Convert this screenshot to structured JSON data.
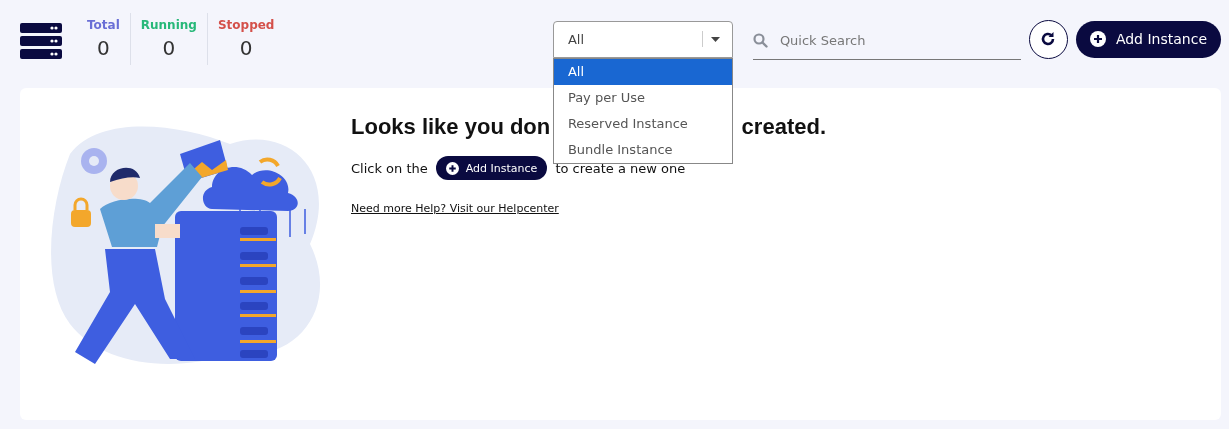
{
  "stats": [
    {
      "label": "Total",
      "value": "0",
      "color": "#6a6fd6"
    },
    {
      "label": "Running",
      "value": "0",
      "color": "#27b879"
    },
    {
      "label": "Stopped",
      "value": "0",
      "color": "#d4504a"
    }
  ],
  "filter": {
    "value": "All",
    "expanded": true,
    "options": [
      {
        "label": "All",
        "selected": true
      },
      {
        "label": "Pay per Use",
        "selected": false
      },
      {
        "label": "Reserved Instance",
        "selected": false
      },
      {
        "label": "Bundle Instance",
        "selected": false
      }
    ]
  },
  "search": {
    "placeholder": "Quick Search"
  },
  "add_button": {
    "label": "Add Instance"
  },
  "empty_state": {
    "heading_start": "Looks like you don",
    "heading_end": "created.",
    "prompt_before": "Click on the",
    "inline_button": "Add Instance",
    "prompt_after": "to create a new one",
    "help_link": "Need more Help? Visit our Helpcenter"
  }
}
